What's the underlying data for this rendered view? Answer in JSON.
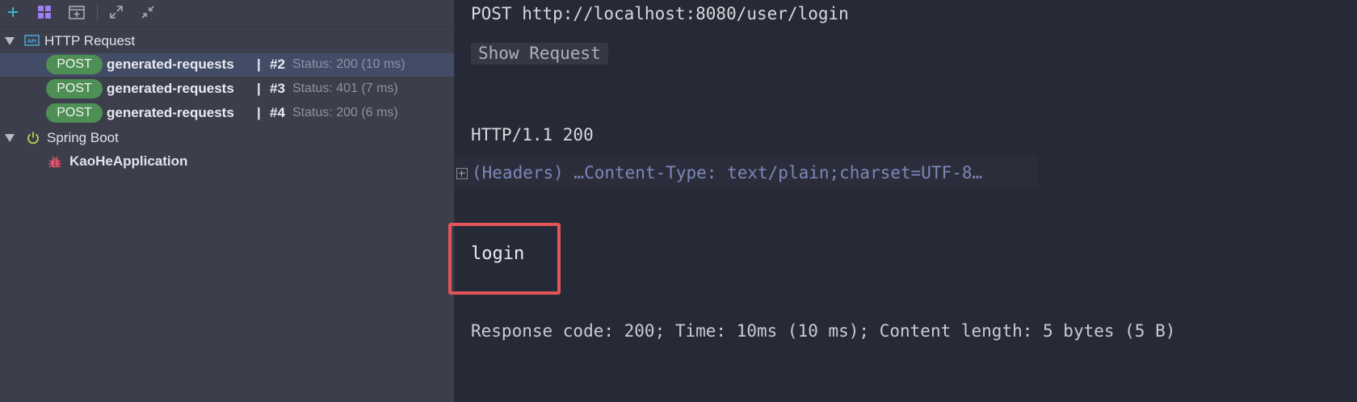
{
  "colors": {
    "post_pill": "#4e8f55",
    "selected_row": "#434c66",
    "highlight_border": "#e3545a",
    "status_gray": "#8d92a2",
    "headers_text": "#7e86b8"
  },
  "toolbar": {
    "icons": [
      "add-icon",
      "grid-icon",
      "add-tab-icon",
      "expand-all-icon",
      "collapse-all-icon"
    ]
  },
  "tree": {
    "http_request": {
      "label": "HTTP Request",
      "icon": "api-icon"
    },
    "requests": [
      {
        "method": "POST",
        "name": "generated-requests",
        "sep": "|",
        "num": "#2",
        "status": "Status: 200 (10 ms)",
        "selected": true
      },
      {
        "method": "POST",
        "name": "generated-requests",
        "sep": "|",
        "num": "#3",
        "status": "Status: 401 (7 ms)",
        "selected": false
      },
      {
        "method": "POST",
        "name": "generated-requests",
        "sep": "|",
        "num": "#4",
        "status": "Status: 200 (6 ms)",
        "selected": false
      }
    ],
    "spring_boot": {
      "label": "Spring Boot",
      "icon": "power-icon"
    },
    "app": {
      "label": "KaoHeApplication",
      "icon": "bug-icon"
    }
  },
  "response": {
    "request_line": "POST http://localhost:8080/user/login",
    "show_request": "Show Request",
    "status_line": "HTTP/1.1 200",
    "headers": "(Headers) …Content-Type: text/plain;charset=UTF-8…",
    "body": "login",
    "summary": "Response code: 200; Time: 10ms (10 ms); Content length: 5 bytes (5 B)"
  }
}
